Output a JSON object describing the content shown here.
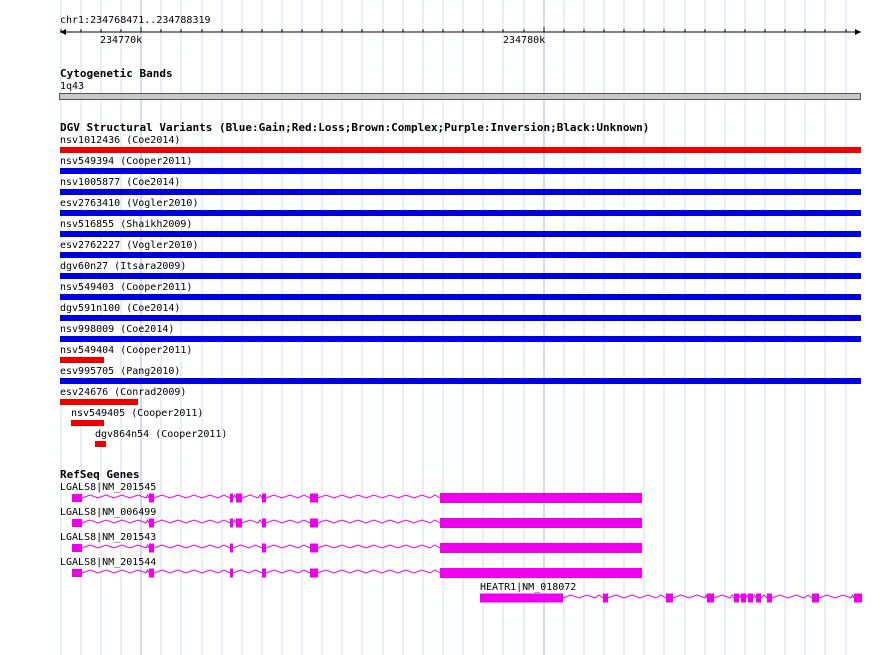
{
  "ruler": {
    "location": "chr1:234768471..234788319",
    "ticks": [
      {
        "label": "234770k",
        "pos": 234770000
      },
      {
        "label": "234780k",
        "pos": 234780000
      }
    ]
  },
  "cytobands": {
    "title": "Cytogenetic Bands",
    "band_name": "1q43",
    "band_color": "#c8c8c8"
  },
  "dgv": {
    "title": "DGV Structural Variants (Blue:Gain;Red:Loss;Brown:Complex;Purple:Inversion;Black:Unknown)",
    "colors": {
      "gain": "#0000e0",
      "loss": "#ee0000"
    },
    "variants": [
      {
        "label": "nsv1012436 (Coe2014)",
        "type": "loss"
      },
      {
        "label": "nsv549394 (Cooper2011)",
        "type": "gain"
      },
      {
        "label": "nsv1005877 (Coe2014)",
        "type": "gain"
      },
      {
        "label": "esv2763410 (Vogler2010)",
        "type": "gain"
      },
      {
        "label": "nsv516855 (Shaikh2009)",
        "type": "gain"
      },
      {
        "label": "esv2762227 (Vogler2010)",
        "type": "gain"
      },
      {
        "label": "dgv60n27 (Itsara2009)",
        "type": "gain"
      },
      {
        "label": "nsv549403 (Cooper2011)",
        "type": "gain"
      },
      {
        "label": "dgv591n100 (Coe2014)",
        "type": "gain"
      },
      {
        "label": "nsv998009 (Coe2014)",
        "type": "gain"
      },
      {
        "label": "nsv549404 (Cooper2011)",
        "type": "loss"
      },
      {
        "label": "esv995705 (Pang2010)",
        "type": "gain"
      },
      {
        "label": "esv24676 (Conrad2009)",
        "type": "loss"
      },
      {
        "label": "nsv549405 (Cooper2011)",
        "type": "loss"
      },
      {
        "label": "dgv864n54 (Cooper2011)",
        "type": "loss"
      }
    ]
  },
  "refseq": {
    "title": "RefSeq Genes",
    "color": "#ee00ee",
    "genes": [
      {
        "label": "LGALS8|NM_201545"
      },
      {
        "label": "LGALS8|NM_006499"
      },
      {
        "label": "LGALS8|NM_201543"
      },
      {
        "label": "LGALS8|NM_201544"
      },
      {
        "label": "HEATR1|NM_018072"
      }
    ]
  }
}
